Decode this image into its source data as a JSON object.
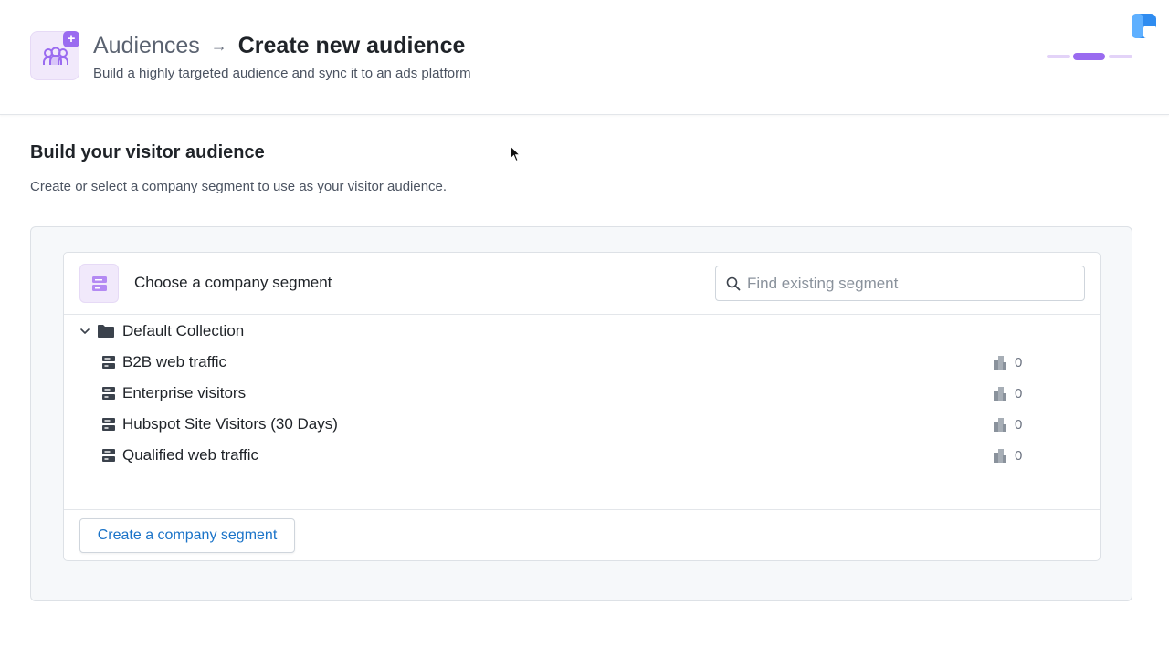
{
  "header": {
    "breadcrumb_parent": "Audiences",
    "breadcrumb_arrow": "→",
    "title": "Create new audience",
    "subtitle": "Build a highly targeted audience and sync it to an ads platform",
    "app_icon": "audience-add-icon",
    "brand_icon": "brand-logo-icon",
    "steps": {
      "total": 3,
      "active_index": 2
    }
  },
  "section": {
    "title": "Build your visitor audience",
    "description": "Create or select a company segment to use as your visitor audience."
  },
  "segment_picker": {
    "title": "Choose a company segment",
    "icon": "segment-icon",
    "search": {
      "placeholder": "Find existing segment",
      "value": ""
    },
    "collection": {
      "name": "Default Collection",
      "expanded": true,
      "segments": [
        {
          "label": "B2B web traffic",
          "count": "0"
        },
        {
          "label": "Enterprise visitors",
          "count": "0"
        },
        {
          "label": "Hubspot Site Visitors (30 Days)",
          "count": "0"
        },
        {
          "label": "Qualified web traffic",
          "count": "0"
        }
      ]
    },
    "create_button_label": "Create a company segment"
  },
  "colors": {
    "accent_purple": "#9a6bf0",
    "link_blue": "#1a73c8",
    "panel_bg": "#f6f8fa"
  }
}
